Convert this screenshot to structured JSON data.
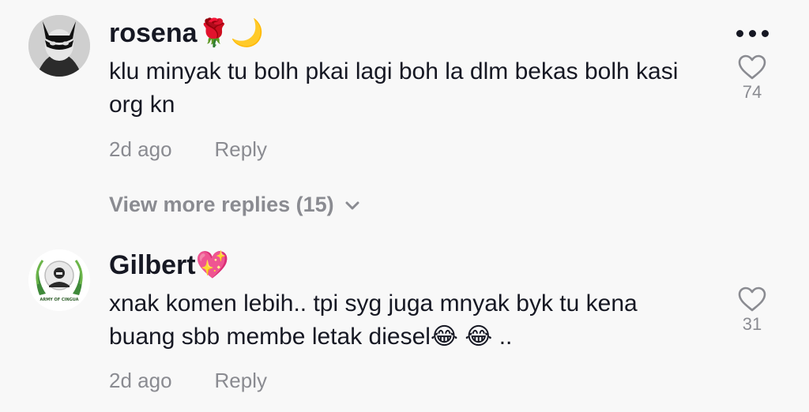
{
  "comments": [
    {
      "username": "rosena",
      "username_emoji": "🌹🌙",
      "text": "klu minyak tu bolh pkai lagi boh la dlm bekas bolh kasi org kn",
      "time": "2d ago",
      "reply_label": "Reply",
      "likes": "74"
    },
    {
      "username": "Gilbert",
      "username_emoji": "💖",
      "text": "xnak komen lebih.. tpi syg juga mnyak byk tu kena buang sbb membe letak diesel😂 😂 ..",
      "time": "2d ago",
      "reply_label": "Reply",
      "likes": "31"
    }
  ],
  "replies_toggle": {
    "label": "View more replies (15)"
  },
  "avatar_badge_text": "ARMY OF CINGUA",
  "colors": {
    "background": "#f8f8f8",
    "text_primary": "#161823",
    "text_secondary": "#8a8b91",
    "rose": "#c8102e",
    "moon": "#f6c945",
    "heart_emoji": "#ff4f9a"
  },
  "icons": [
    "more-options-icon",
    "heart-outline-icon",
    "chevron-down-icon"
  ]
}
